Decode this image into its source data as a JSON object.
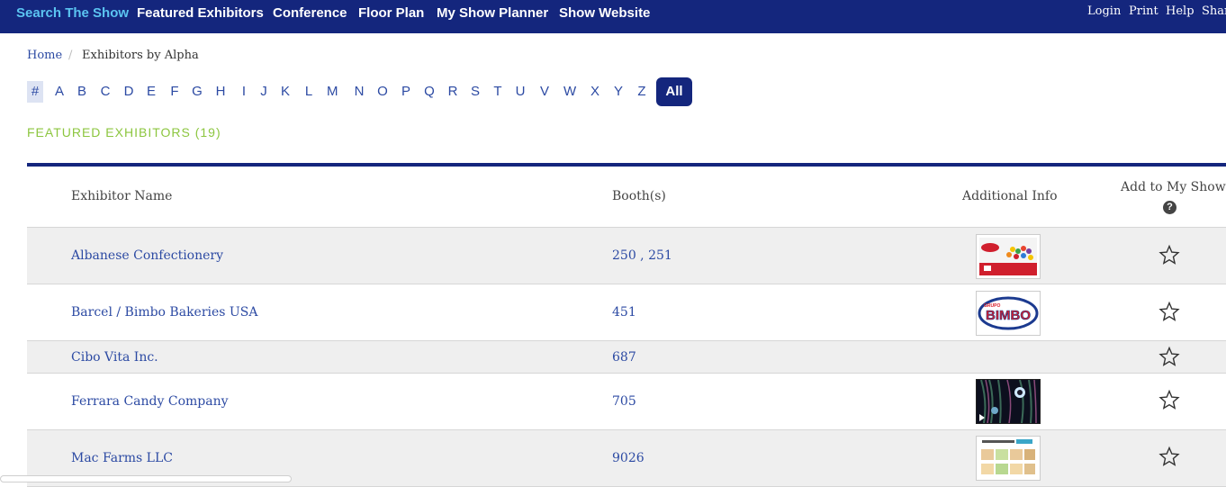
{
  "topnav": {
    "items": [
      "Search The Show",
      "Featured Exhibitors",
      "Conference",
      "Floor Plan",
      "My Show Planner",
      "Show Website"
    ],
    "utility": [
      "Login",
      "Print",
      "Help",
      "Shar"
    ],
    "bg_color": "#14267d",
    "active_color": "#5bc4f1"
  },
  "breadcrumb": {
    "home": "Home",
    "separator": "/",
    "current": "Exhibitors by Alpha"
  },
  "alpha_filter": {
    "hash": "#",
    "letters": [
      "A",
      "B",
      "C",
      "D",
      "E",
      "F",
      "G",
      "H",
      "I",
      "J",
      "K",
      "L",
      "M",
      "N",
      "O",
      "P",
      "Q",
      "R",
      "S",
      "T",
      "U",
      "V",
      "W",
      "X",
      "Y",
      "Z"
    ],
    "all": "All",
    "selected": "All"
  },
  "section_title": "FEATURED EXHIBITORS (19)",
  "table": {
    "headers": {
      "name": "Exhibitor Name",
      "booths": "Booth(s)",
      "info": "Additional Info",
      "add": "Add to My Show",
      "help": "?"
    },
    "rows": [
      {
        "name": "Albanese Confectionery",
        "booth": "250 , 251",
        "thumb": "albanese-bag",
        "star": "☆"
      },
      {
        "name": "Barcel / Bimbo Bakeries USA",
        "booth": "451",
        "thumb": "bimbo-logo",
        "star": "☆",
        "thumb_top_text": "GRUPO",
        "thumb_text": "BIMBO"
      },
      {
        "name": "Cibo Vita Inc.",
        "booth": "687",
        "thumb": "",
        "star": "☆"
      },
      {
        "name": "Ferrara Candy Company",
        "booth": "705",
        "thumb": "video-still",
        "star": "☆"
      },
      {
        "name": "Mac Farms LLC",
        "booth": "9026",
        "thumb": "product-grid",
        "star": "☆"
      }
    ]
  },
  "colors": {
    "link": "#2c4aa3",
    "accent_green": "#8cc63f",
    "row_shade": "#efefef"
  }
}
